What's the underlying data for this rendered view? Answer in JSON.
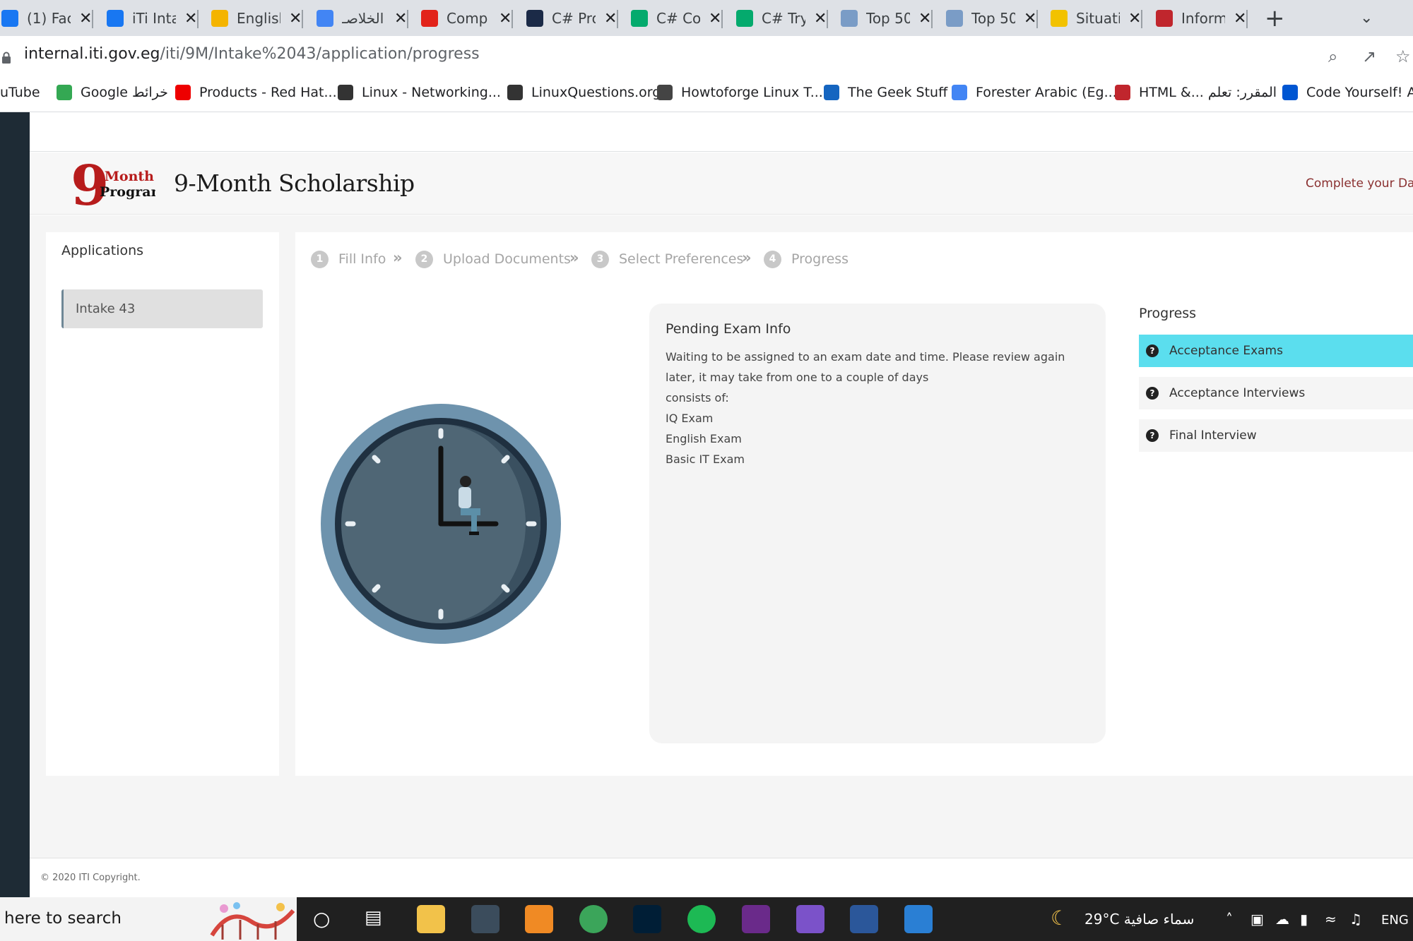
{
  "browser": {
    "tabs": [
      {
        "title": "(1) Fac",
        "icon": "facebook-icon",
        "color": "#1877f2"
      },
      {
        "title": "iTi Inta",
        "icon": "facebook-icon",
        "color": "#1877f2"
      },
      {
        "title": "English",
        "icon": "google-drive-icon",
        "color": "#f4b400"
      },
      {
        "title": "الخلاصـ",
        "icon": "google-docs-icon",
        "color": "#4285f4"
      },
      {
        "title": "Comp",
        "icon": "brand-v-icon",
        "color": "#e2231a"
      },
      {
        "title": "C# Pro",
        "icon": "sf-icon",
        "color": "#1b2a47"
      },
      {
        "title": "C# Co",
        "icon": "w3schools-icon",
        "color": "#04aa6d"
      },
      {
        "title": "C# Try",
        "icon": "w3schools-icon",
        "color": "#04aa6d"
      },
      {
        "title": "Top 50",
        "icon": "chart-icon",
        "color": "#7a9cc6"
      },
      {
        "title": "Top 50",
        "icon": "chart-icon",
        "color": "#7a9cc6"
      },
      {
        "title": "Situati",
        "icon": "checkbox-icon",
        "color": "#f2c200"
      },
      {
        "title": "Inform",
        "icon": "iti-icon",
        "color": "#c0262d"
      }
    ],
    "new_tab": "+",
    "url_host": "internal.iti.gov.eg",
    "url_path": "/iti/9M/Intake%2043/application/progress",
    "bookmarks": [
      {
        "label": "uTube",
        "icon": "",
        "color": ""
      },
      {
        "label": "Google خرائط",
        "icon": "google-maps-icon",
        "color": "#34a853"
      },
      {
        "label": "Products - Red Hat...",
        "icon": "redhat-icon",
        "color": "#e00"
      },
      {
        "label": "Linux - Networking...",
        "icon": "tux-icon",
        "color": "#333"
      },
      {
        "label": "LinuxQuestions.org",
        "icon": "tux-icon",
        "color": "#333"
      },
      {
        "label": "Howtoforge Linux T...",
        "icon": "howtoforge-icon",
        "color": "#444"
      },
      {
        "label": "The Geek Stuff",
        "icon": "geekstuff-icon",
        "color": "#1565c0"
      },
      {
        "label": "Forester Arabic (Eg...",
        "icon": "google-docs-icon",
        "color": "#4285f4"
      },
      {
        "label": "HTML &... المقرر: تعلم",
        "icon": "iti-icon",
        "color": "#c0262d"
      },
      {
        "label": "Code Yourself! An",
        "icon": "coursera-icon",
        "color": "#0056d2"
      }
    ]
  },
  "site": {
    "logo_number": "9",
    "logo_word1": "-Month",
    "logo_word2": "Program",
    "brand_title": "9-Month Scholarship",
    "header_link": "Complete your Dat",
    "copyright": "© 2020 ITI Copyright."
  },
  "sidebar": {
    "title": "Applications",
    "items": [
      "Intake 43"
    ]
  },
  "steps": [
    {
      "num": "1",
      "label": "Fill Info"
    },
    {
      "num": "2",
      "label": "Upload Documents"
    },
    {
      "num": "3",
      "label": "Select Preferences"
    },
    {
      "num": "4",
      "label": "Progress"
    }
  ],
  "info": {
    "title": "Pending Exam Info",
    "lines": [
      "Waiting to be assigned to an exam date and time. Please review again",
      "later, it may take from one to a couple of days",
      "consists of:",
      "IQ Exam",
      "English Exam",
      "Basic IT Exam"
    ]
  },
  "progress": {
    "title": "Progress",
    "items": [
      {
        "label": "Acceptance Exams",
        "active": true
      },
      {
        "label": "Acceptance Interviews",
        "active": false
      },
      {
        "label": "Final Interview",
        "active": false
      }
    ],
    "active_color": "#5bdeee"
  },
  "taskbar": {
    "search_placeholder": "here to search",
    "weather": "29°C سماء صافية",
    "lang": "ENG"
  }
}
